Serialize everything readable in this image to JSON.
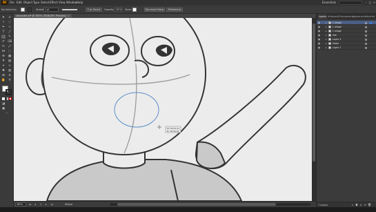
{
  "app": {
    "logo": "Ai"
  },
  "menu": {
    "items": [
      "File",
      "Edit",
      "Object",
      "Type",
      "Select",
      "Effect",
      "View",
      "Window",
      "Help"
    ],
    "workspace": "Essentials"
  },
  "control_bar": {
    "selection": "No Selection",
    "stroke_label": "Stroke:",
    "stroke_value": "1 pt",
    "brush": "5 pt. Round",
    "opacity_label": "Opacity:",
    "opacity_value": "100%",
    "style_label": "Style:",
    "doc_setup": "Document Setup",
    "preferences": "Preferences"
  },
  "document": {
    "tab_title": "character.ai* @ 385% (RGB/GPU Preview)",
    "close": "×"
  },
  "canvas": {
    "measure_line1": "W: 30.21 px",
    "measure_line2": "H: 19.44 px"
  },
  "status": {
    "zoom": "385%",
    "artboard": "1",
    "tool_name": "Ellipse"
  },
  "panel": {
    "tabs": [
      "Layers",
      "Artboards",
      "Transparency",
      "Appearance",
      "Libraries"
    ],
    "layers": [
      {
        "name": "L shape",
        "selected": true
      },
      {
        "name": "L shape",
        "selected": false
      },
      {
        "name": "L shape",
        "selected": false
      },
      {
        "name": "Hat",
        "selected": false
      },
      {
        "name": "Layer 3",
        "selected": false
      },
      {
        "name": "Head",
        "selected": false
      },
      {
        "name": "Layer 1",
        "selected": false
      }
    ],
    "footer_count": "7 Layers"
  },
  "colors": {
    "selection_blue": "#3e7bd9",
    "app_orange": "#ff9a00"
  }
}
